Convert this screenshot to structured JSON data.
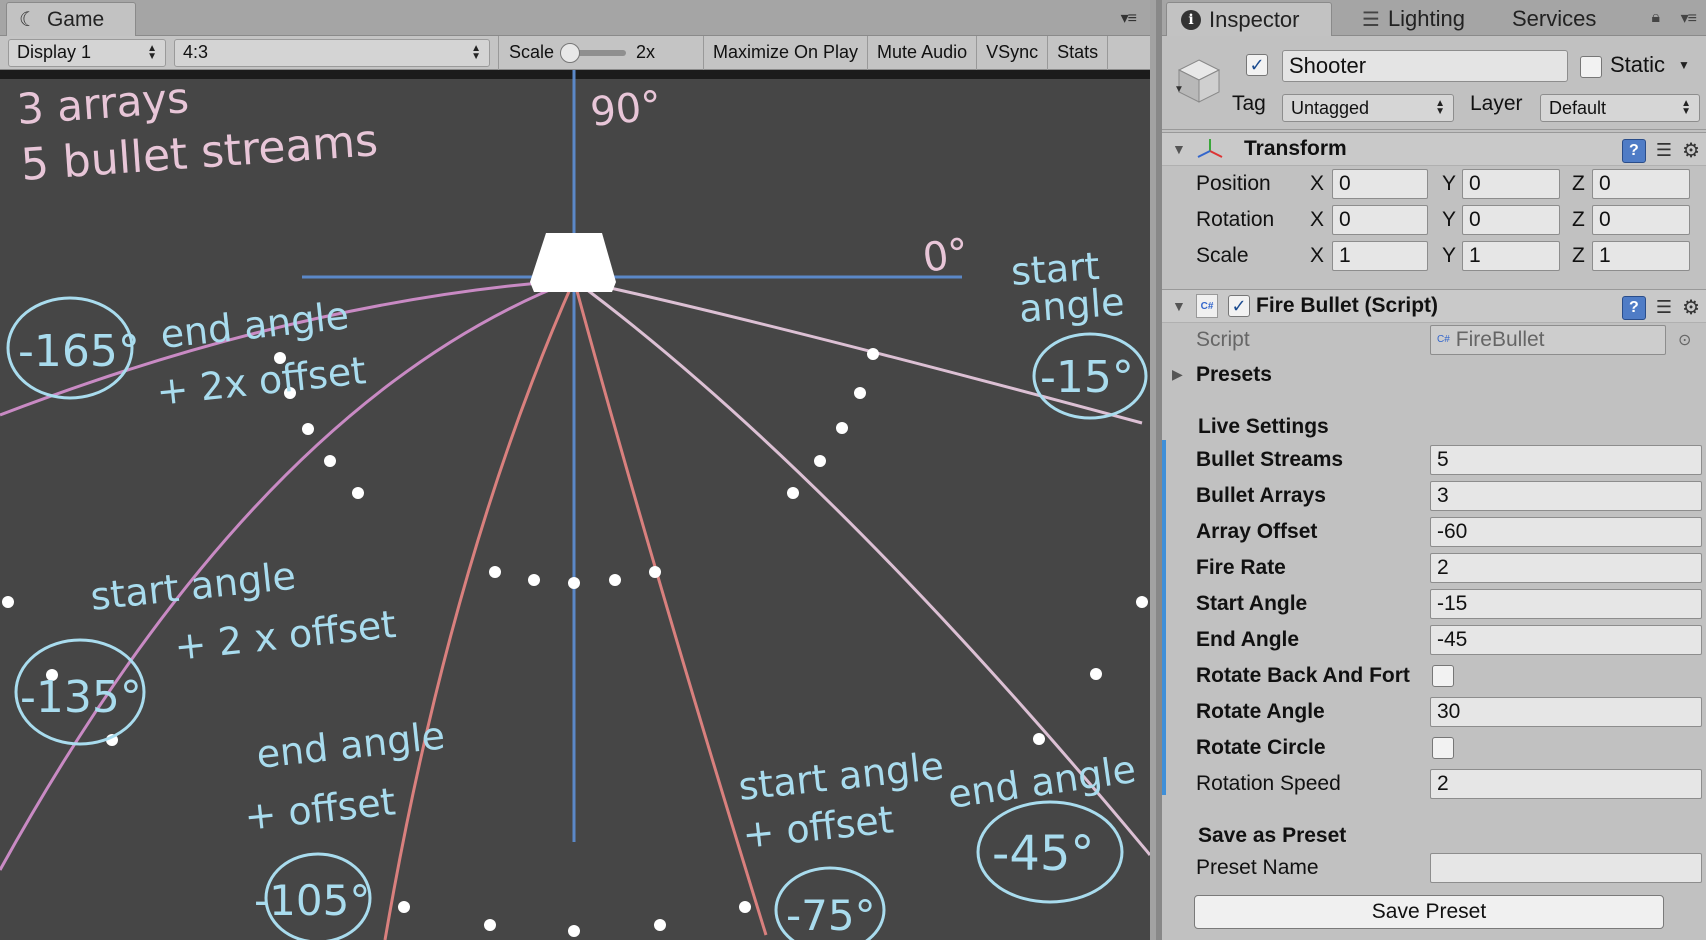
{
  "game": {
    "tab_label": "Game",
    "display_label": "Display 1",
    "aspect_label": "4:3",
    "scale_label": "Scale",
    "scale_value": "2x",
    "buttons": [
      "Maximize On Play",
      "Mute Audio",
      "VSync",
      "Stats"
    ],
    "annotations": {
      "title_line1": "3 arrays",
      "title_line2": "5 bullet streams",
      "deg_90": "90°",
      "deg_0": "0°",
      "start_angle_label_1": "start",
      "start_angle_label_2": "angle",
      "start_angle_value": "-15°",
      "end_angle_2x_line1": "end angle",
      "end_angle_2x_line2": "+ 2x offset",
      "end_angle_2x_value": "-165°",
      "start_angle_2x_line1": "start angle",
      "start_angle_2x_line2": "+ 2 x offset",
      "start_angle_2x_value": "-135°",
      "end_angle_1x_line1": "end angle",
      "end_angle_1x_line2": "+ offset",
      "end_angle_1x_value": "-105°",
      "start_angle_1x_line1": "start angle",
      "start_angle_1x_line2": "+ offset",
      "start_angle_1x_value": "-75°",
      "end_angle_line1": "end angle",
      "end_angle_value": "-45°"
    },
    "colors": {
      "background": "#464646",
      "axis": "#5b88c8",
      "annotation_blue": "#a9dcee",
      "annotation_pink": "#e8c6d8",
      "stream_purple": "#c98ac4",
      "stream_red": "#d9807e",
      "stream_light": "#dcc0d4",
      "bullet": "#ffffff"
    }
  },
  "inspector": {
    "tabs": [
      "Inspector",
      "Lighting",
      "Services"
    ],
    "object_name": "Shooter",
    "static_label": "Static",
    "tag_label": "Tag",
    "tag_value": "Untagged",
    "layer_label": "Layer",
    "layer_value": "Default",
    "transform": {
      "title": "Transform",
      "rows": [
        {
          "label": "Position",
          "x": "0",
          "y": "0",
          "z": "0"
        },
        {
          "label": "Rotation",
          "x": "0",
          "y": "0",
          "z": "0"
        },
        {
          "label": "Scale",
          "x": "1",
          "y": "1",
          "z": "1"
        }
      ],
      "axis_x": "X",
      "axis_y": "Y",
      "axis_z": "Z"
    },
    "fire_bullet": {
      "title": "Fire Bullet (Script)",
      "script_label": "Script",
      "script_value": "FireBullet",
      "presets_label": "Presets",
      "live_settings_label": "Live Settings",
      "bullet_streams_label": "Bullet Streams",
      "bullet_streams": "5",
      "bullet_arrays_label": "Bullet Arrays",
      "bullet_arrays": "3",
      "array_offset_label": "Array Offset",
      "array_offset": "-60",
      "fire_rate_label": "Fire Rate",
      "fire_rate": "2",
      "start_angle_label": "Start Angle",
      "start_angle": "-15",
      "end_angle_label": "End Angle",
      "end_angle": "-45",
      "rotate_back_label": "Rotate Back And Fort",
      "rotate_angle_label": "Rotate Angle",
      "rotate_angle": "30",
      "rotate_circle_label": "Rotate Circle",
      "rotation_speed_label": "Rotation Speed",
      "rotation_speed": "2",
      "save_preset_label": "Save as Preset",
      "preset_name_label": "Preset Name",
      "preset_name": "",
      "save_button": "Save Preset"
    }
  }
}
